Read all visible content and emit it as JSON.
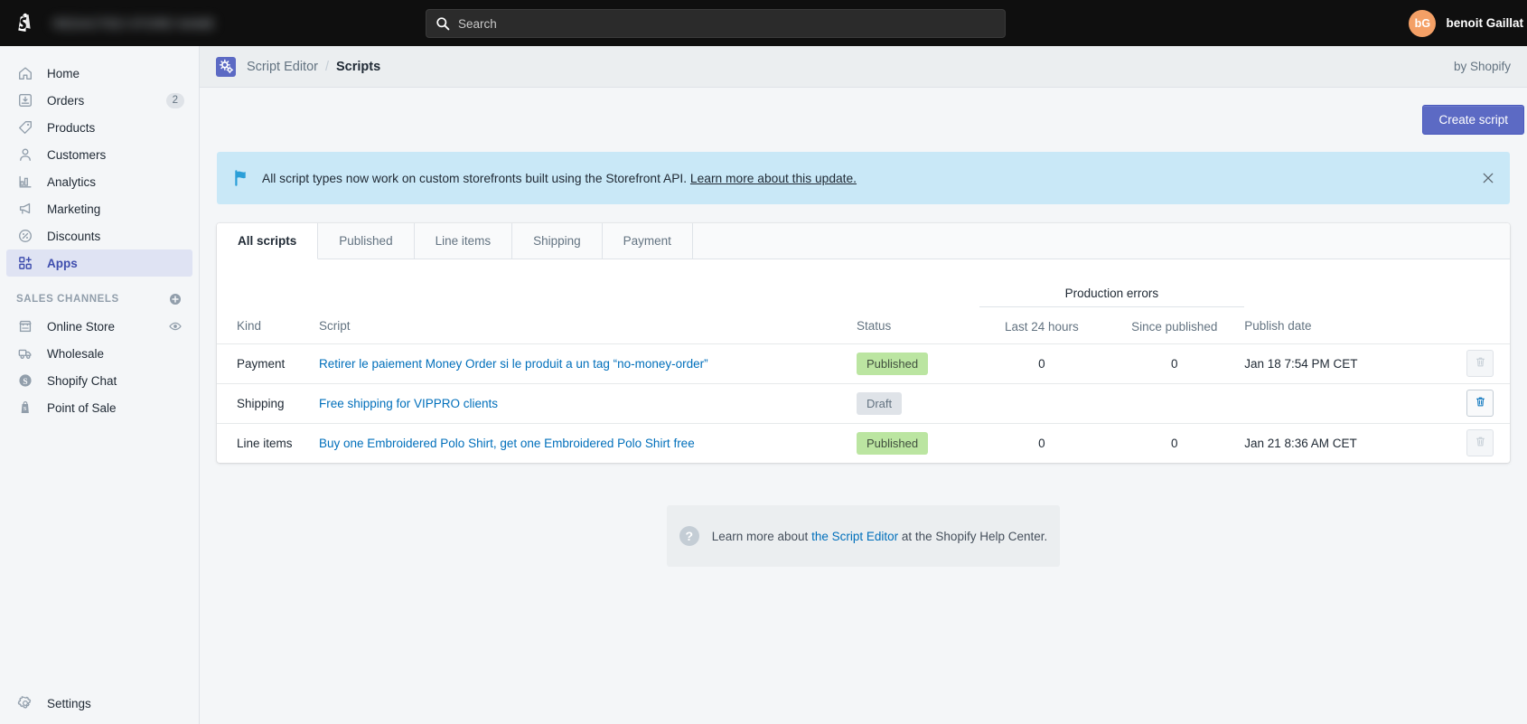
{
  "topbar": {
    "store_name": "REDACTED STORE NAME",
    "search_placeholder": "Search",
    "search_value": "",
    "search_icon": "search-icon",
    "user_initials": "bG",
    "user_name": "benoit Gaillat",
    "avatar_color": "#f4a066"
  },
  "sidebar": {
    "items": [
      {
        "label": "Home",
        "icon": "home-icon",
        "badge": ""
      },
      {
        "label": "Orders",
        "icon": "orders-icon",
        "badge": "2"
      },
      {
        "label": "Products",
        "icon": "products-tag-icon",
        "badge": ""
      },
      {
        "label": "Customers",
        "icon": "customers-person-icon",
        "badge": ""
      },
      {
        "label": "Analytics",
        "icon": "analytics-bars-icon",
        "badge": ""
      },
      {
        "label": "Marketing",
        "icon": "marketing-megaphone-icon",
        "badge": ""
      },
      {
        "label": "Discounts",
        "icon": "discounts-percent-icon",
        "badge": ""
      },
      {
        "label": "Apps",
        "icon": "apps-grid-plus-icon",
        "badge": "",
        "active": true
      }
    ],
    "section_title": "SALES CHANNELS",
    "section_add_icon": "add-circle-icon",
    "channels": [
      {
        "label": "Online Store",
        "icon": "storefront-icon",
        "trailing_icon": "eye-icon"
      },
      {
        "label": "Wholesale",
        "icon": "wholesale-truck-icon",
        "trailing_icon": ""
      },
      {
        "label": "Shopify Chat",
        "icon": "shopify-chat-icon",
        "trailing_icon": ""
      },
      {
        "label": "Point of Sale",
        "icon": "point-of-sale-bag-icon",
        "trailing_icon": ""
      }
    ],
    "settings": {
      "label": "Settings",
      "icon": "gear-icon"
    }
  },
  "app_header": {
    "app_icon": "script-editor-gears-icon",
    "breadcrumb_parent": "Script Editor",
    "breadcrumb_separator": "/",
    "breadcrumb_current": "Scripts",
    "by_line": "by Shopify"
  },
  "actions": {
    "create_script_label": "Create script",
    "primary_color": "#5c6ac4"
  },
  "banner": {
    "icon": "flag-icon",
    "text": "All script types now work on custom storefronts built using the Storefront API.",
    "link_text": "Learn more about this update.",
    "close_icon": "close-icon",
    "background_color": "#c9e8f7"
  },
  "tabs": [
    {
      "label": "All scripts",
      "active": true
    },
    {
      "label": "Published",
      "active": false
    },
    {
      "label": "Line items",
      "active": false
    },
    {
      "label": "Shipping",
      "active": false
    },
    {
      "label": "Payment",
      "active": false
    }
  ],
  "table": {
    "group_header": "Production errors",
    "columns": {
      "kind": "Kind",
      "script": "Script",
      "status": "Status",
      "last_24_hours": "Last 24 hours",
      "since_published": "Since published",
      "publish_date": "Publish date"
    },
    "rows": [
      {
        "kind": "Payment",
        "script": "Retirer le paiement Money Order si le produit a un tag “no-money-order”",
        "status": "Published",
        "status_type": "published",
        "last_24_hours": "0",
        "since_published": "0",
        "publish_date": "Jan 18 7:54 PM CET",
        "delete_icon": "trash-icon",
        "delete_enabled": false
      },
      {
        "kind": "Shipping",
        "script": "Free shipping for VIPPRO clients",
        "status": "Draft",
        "status_type": "draft",
        "last_24_hours": "",
        "since_published": "",
        "publish_date": "",
        "delete_icon": "trash-icon",
        "delete_enabled": true
      },
      {
        "kind": "Line items",
        "script": "Buy one Embroidered Polo Shirt, get one Embroidered Polo Shirt free",
        "status": "Published",
        "status_type": "published",
        "last_24_hours": "0",
        "since_published": "0",
        "publish_date": "Jan 21 8:36 AM CET",
        "delete_icon": "trash-icon",
        "delete_enabled": false
      }
    ]
  },
  "footer": {
    "help_icon": "question-mark-icon",
    "text_before": "Learn more about",
    "link_text": "the Script Editor",
    "text_after": "at the Shopify Help Center."
  }
}
